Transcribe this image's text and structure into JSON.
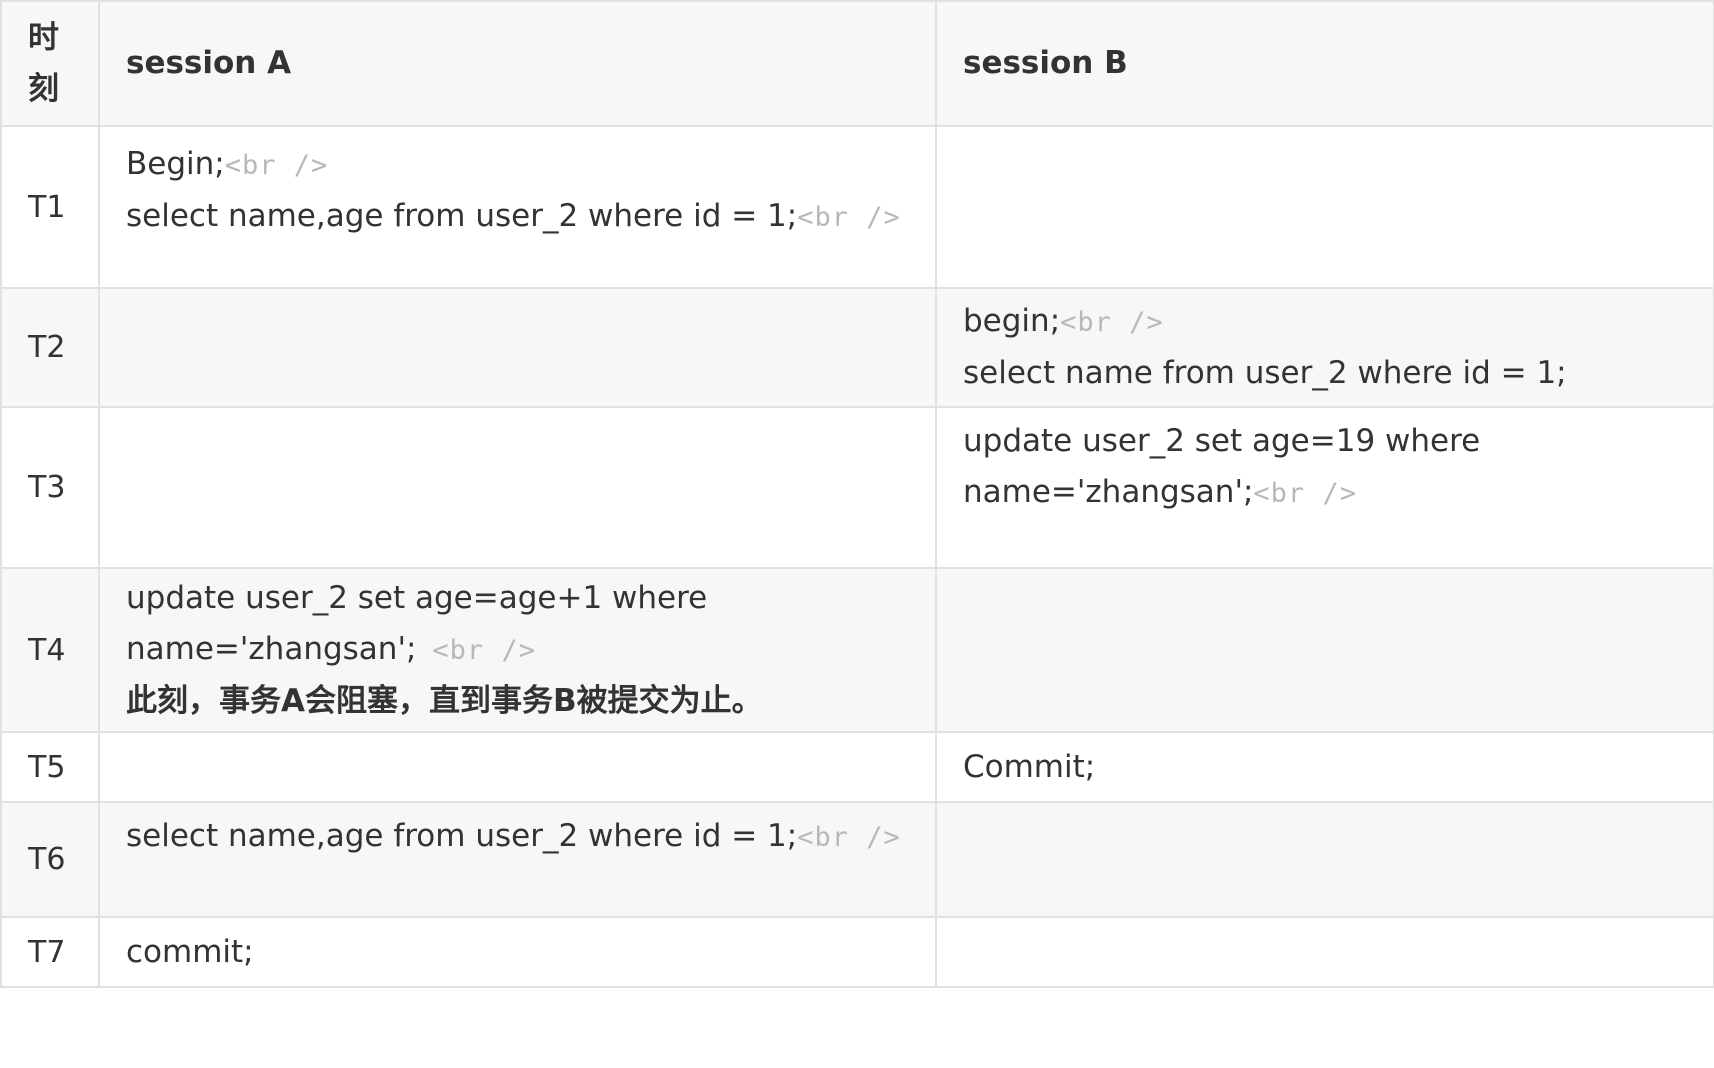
{
  "table": {
    "headers": {
      "time_line1": "时",
      "time_line2": "刻",
      "session_a": "session A",
      "session_b": "session B"
    },
    "br_tag": "<br />",
    "rows": [
      {
        "time": "T1",
        "a_lines": [
          "Begin;",
          "select name,age from user_2 where id = 1;"
        ],
        "b_lines": []
      },
      {
        "time": "T2",
        "a_lines": [],
        "b_lines": [
          "begin;",
          "select name from user_2 where id = 1;"
        ]
      },
      {
        "time": "T3",
        "a_lines": [],
        "b_lines": [
          "update user_2 set age=19 where",
          "name='zhangsan';"
        ]
      },
      {
        "time": "T4",
        "a_lines": [
          "update user_2 set age=age+1 where",
          "name='zhangsan';"
        ],
        "a_note": "此刻，事务A会阻塞，直到事务B被提交为止。",
        "b_lines": []
      },
      {
        "time": "T5",
        "a_lines": [],
        "b_lines": [
          "Commit;"
        ]
      },
      {
        "time": "T6",
        "a_lines": [
          "select name,age from user_2 where id = 1;"
        ],
        "b_lines": []
      },
      {
        "time": "T7",
        "a_lines": [
          "commit;"
        ],
        "b_lines": []
      }
    ]
  }
}
